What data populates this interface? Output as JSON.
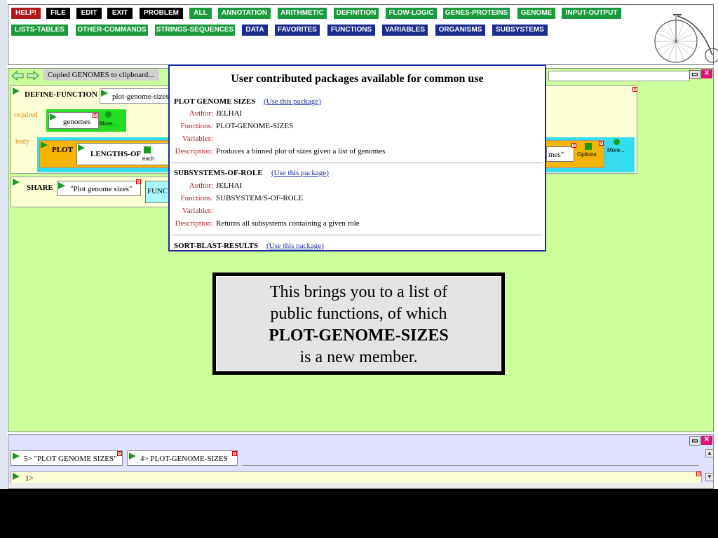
{
  "toolbar": {
    "row1": [
      "HELP!",
      "FILE",
      "EDIT",
      "EXIT",
      "PROBLEM",
      "ALL",
      "ANNOTATION",
      "ARITHMETIC",
      "DEFINITION",
      "FLOW-LOGIC",
      "GENES-PROTEINS",
      "GENOME",
      "INPUT-OUTPUT"
    ],
    "row2": [
      "LISTS-TABLES",
      "OTHER-COMMANDS",
      "STRINGS-SEQUENCES",
      "DATA",
      "FAVORITES",
      "FUNCTIONS",
      "VARIABLES",
      "ORGANISMS",
      "SUBSYSTEMS"
    ],
    "colors": {
      "black": "#000000",
      "red": "#b01818",
      "green": "#199a3c",
      "blue": "#1c2d8f"
    }
  },
  "workspace": {
    "status": "Copied GENOMES to clipboard...",
    "define": {
      "keyword": "DEFINE-FUNCTION",
      "name": "plot-genome-sizes",
      "required_label": "required",
      "required_param": "genomes",
      "more": "More...",
      "body_label": "body",
      "plot": "PLOT",
      "lengths_of": "LENGTHS-OF",
      "each": "each",
      "arg_tail": "mes\"",
      "options": "Options",
      "more2": "More..."
    },
    "share": {
      "keyword": "SHARE",
      "value": "\"Plot genome sizes\"",
      "func_stub": "FUNC"
    }
  },
  "popup": {
    "title": "User contributed packages available for common use",
    "use_link": "(Use this package)",
    "labels": {
      "author": "Author:",
      "functions": "Functions:",
      "variables": "Variables:",
      "description": "Description:"
    },
    "packages": [
      {
        "name": "PLOT GENOME SIZES",
        "author": "JELHAI",
        "functions": "PLOT-GENOME-SIZES",
        "variables": "",
        "description": "Produces a binned plot of sizes given a list of genomes"
      },
      {
        "name": "SUBSYSTEMS-OF-ROLE",
        "author": "JELHAI",
        "functions": "SUBSYSTEM/S-OF-ROLE",
        "variables": "",
        "description": "Returns all subsystems containing a given role"
      },
      {
        "name": "SORT-BLAST-RESULTS"
      }
    ]
  },
  "callout": {
    "line1": "This brings you to a list of",
    "line2": "public functions, of which",
    "line3": "PLOT-GENOME-SIZES",
    "line4": "is a new member."
  },
  "history": {
    "items": [
      "5>  \"PLOT GENOME SIZES\"",
      "4>  PLOT-GENOME-SIZES"
    ],
    "prompt": "1>"
  },
  "colors": {
    "workspace_bg": "#ccff99",
    "bottom_bg": "#e0e0ff",
    "popup_border": "#1a2ba8",
    "link": "#1a2ba8",
    "field_label": "#b02020",
    "define_bg": "#ffffd6",
    "plot_bg": "#f4b400",
    "cyan_bg": "#33ddee",
    "green_bg": "#22dd22",
    "flag": "#1a9a1a"
  },
  "icons": {
    "nav_back": "arrow-left-icon",
    "nav_forward": "arrow-right-icon",
    "bike": "penny-farthing-bicycle-icon",
    "minimize": "minimize-icon",
    "close": "close-icon",
    "flag": "green-flag-icon",
    "delete": "delete-x-icon",
    "more": "more-circle-icon",
    "each": "each-arrow-icon"
  }
}
